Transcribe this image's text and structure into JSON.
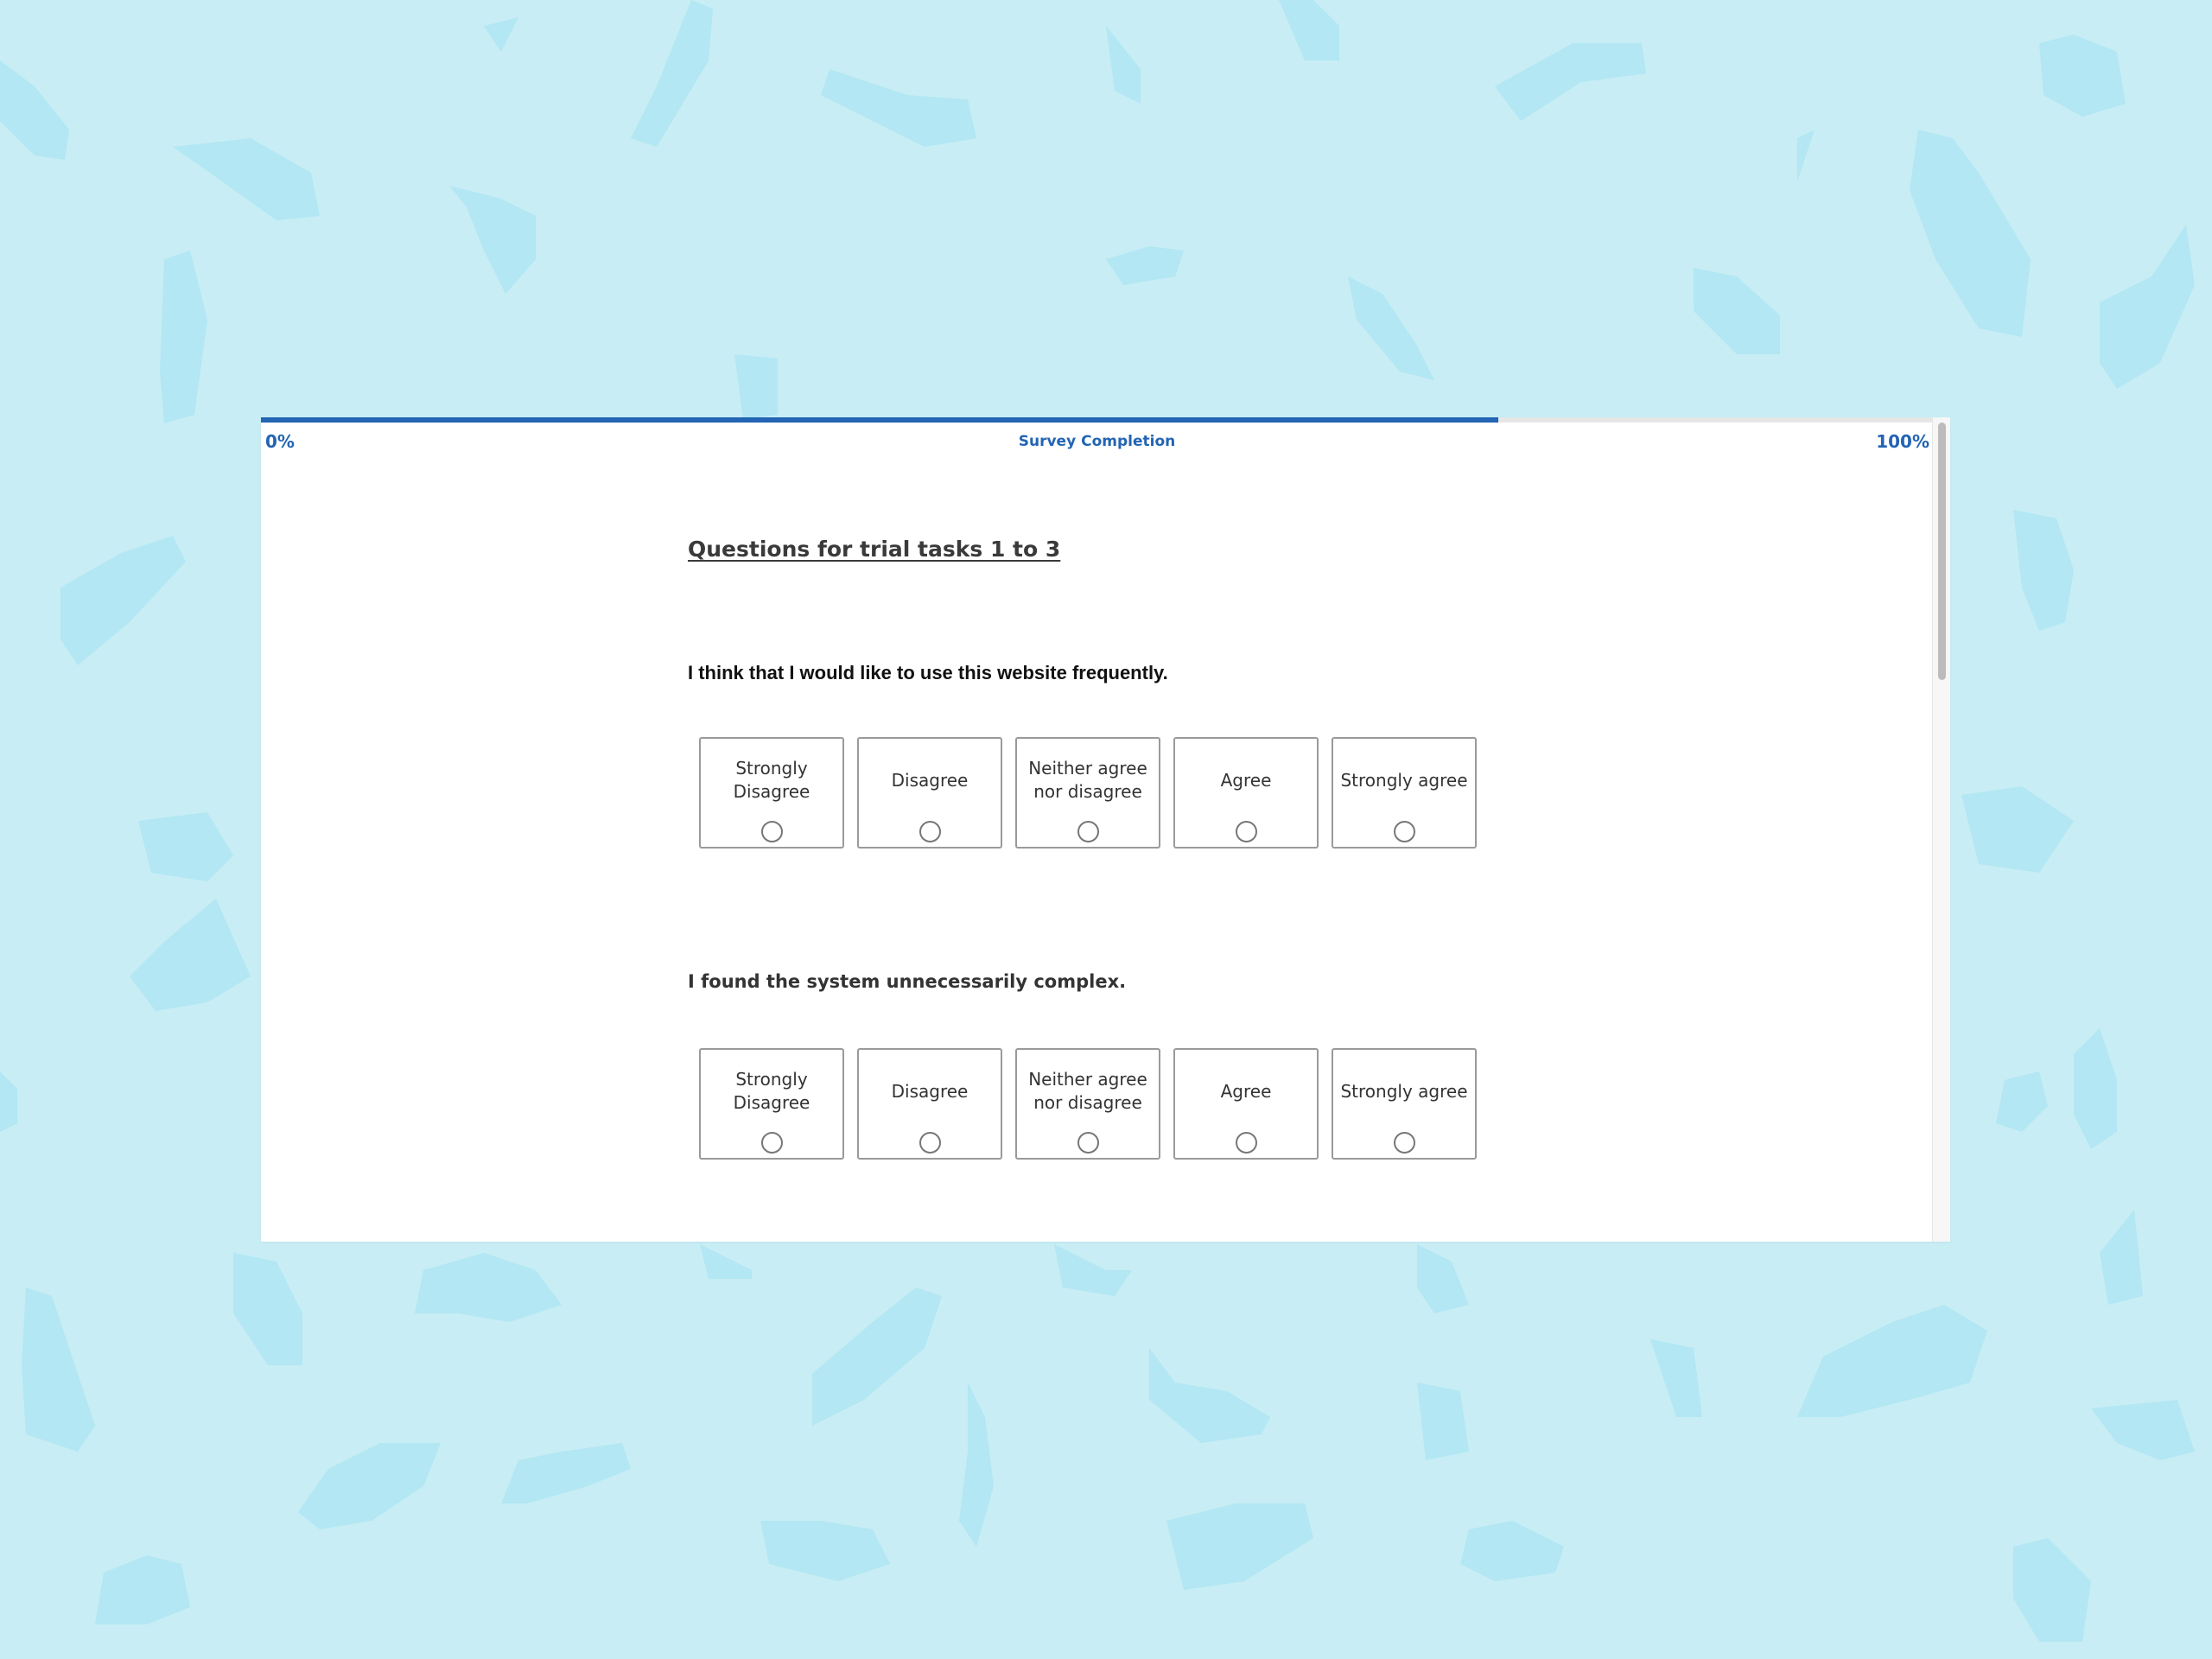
{
  "progress": {
    "min_label": "0%",
    "max_label": "100%",
    "title": "Survey Completion",
    "value_percent": 74
  },
  "survey": {
    "title": "Questions for trial tasks 1 to 3",
    "questions": [
      {
        "text": "I think that I would like to use this website frequently.",
        "options": [
          "Strongly Disagree",
          "Disagree",
          "Neither agree nor disagree",
          "Agree",
          "Strongly agree"
        ]
      },
      {
        "text": "I found the system unnecessarily complex.",
        "options": [
          "Strongly Disagree",
          "Disagree",
          "Neither agree nor disagree",
          "Agree",
          "Strongly agree"
        ]
      }
    ]
  },
  "colors": {
    "accent": "#2364b4",
    "background": "#c8edf5",
    "background_shapes": "#b2e7f3"
  }
}
